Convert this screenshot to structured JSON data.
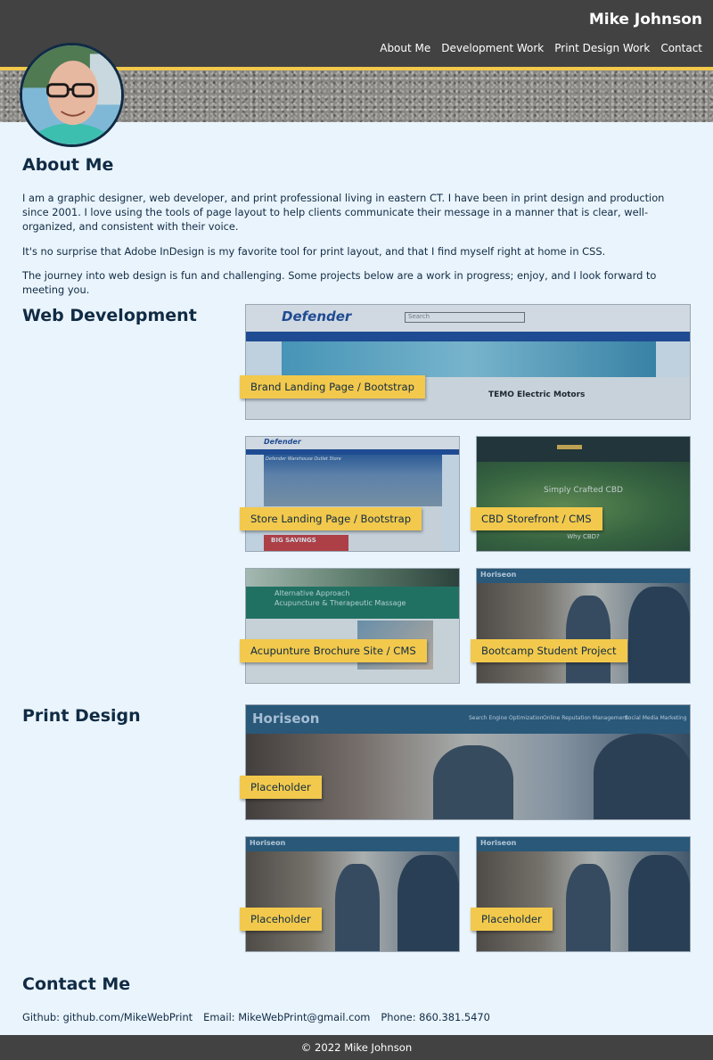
{
  "header": {
    "site_name": "Mike Johnson",
    "nav": [
      "About Me",
      "Development Work",
      "Print Design Work",
      "Contact"
    ]
  },
  "colors": {
    "header_bg": "#424242",
    "accent": "#f2c94c",
    "page_bg": "#eaf4fc",
    "text": "#102b44"
  },
  "about": {
    "heading": "About Me",
    "paragraphs": [
      "I am a graphic designer, web developer, and print professional living in eastern CT. I have been in print design and production since 2001. I love using the tools of page layout to help clients communicate their message in a manner that is clear, well-organized, and consistent with their voice.",
      "It's no surprise that Adobe InDesign is my favorite tool for print layout, and that I find myself right at home in CSS.",
      "The journey into web design is fun and challenging. Some projects below are a work in progress; enjoy, and I look forward to meeting you."
    ]
  },
  "web_dev": {
    "heading": "Web Development",
    "projects": [
      {
        "label": "Brand Landing Page / Bootstrap",
        "shot_text": {
          "logo": "Defender",
          "headline": "TEMO Electric Motors",
          "search": "Search"
        }
      },
      {
        "label": "Store Landing Page / Bootstrap",
        "shot_text": {
          "logo": "Defender",
          "banner": "Defender Warehouse Outlet Store",
          "promo": "BIG SAVINGS"
        }
      },
      {
        "label": "CBD Storefront / CMS",
        "shot_text": {
          "headline": "Simply Crafted CBD",
          "sub": "Why CBD?"
        }
      },
      {
        "label": "Acupunture Brochure Site / CMS",
        "shot_text": {
          "headline": "Alternative Approach",
          "sub": "Acupuncture & Therapeutic Massage"
        }
      },
      {
        "label": "Bootcamp Student Project",
        "shot_text": {
          "logo": "Horiseon"
        }
      }
    ]
  },
  "print": {
    "heading": "Print Design",
    "projects": [
      {
        "label": "Placeholder",
        "shot_text": {
          "logo": "Horiseon",
          "nav": [
            "Search Engine Optimization",
            "Online Reputation Management",
            "Social Media Marketing"
          ]
        }
      },
      {
        "label": "Placeholder",
        "shot_text": {
          "logo": "Horiseon"
        }
      },
      {
        "label": "Placeholder",
        "shot_text": {
          "logo": "Horiseon"
        }
      }
    ]
  },
  "contact": {
    "heading": "Contact Me",
    "github": "Github: github.com/MikeWebPrint",
    "email": "Email: MikeWebPrint@gmail.com",
    "phone": "Phone: 860.381.5470"
  },
  "footer": {
    "text": "© 2022 Mike Johnson"
  }
}
